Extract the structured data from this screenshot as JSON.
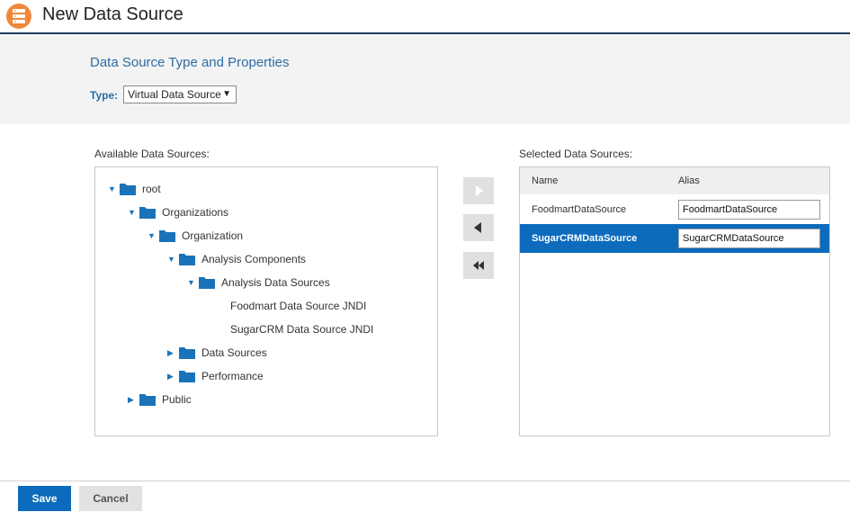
{
  "header": {
    "title": "New Data Source",
    "icon": "database-icon",
    "accent": "#f0883a"
  },
  "properties": {
    "heading": "Data Source Type and Properties",
    "type_label": "Type:",
    "type_value": "Virtual Data Source"
  },
  "available": {
    "label": "Available Data Sources:",
    "tree": [
      {
        "label": "root",
        "depth": 0,
        "expanded": true,
        "folder": true
      },
      {
        "label": "Organizations",
        "depth": 1,
        "expanded": true,
        "folder": true
      },
      {
        "label": "Organization",
        "depth": 2,
        "expanded": true,
        "folder": true
      },
      {
        "label": "Analysis Components",
        "depth": 3,
        "expanded": true,
        "folder": true
      },
      {
        "label": "Analysis Data Sources",
        "depth": 4,
        "expanded": true,
        "folder": true
      },
      {
        "label": "Foodmart Data Source JNDI",
        "depth": 5,
        "folder": false
      },
      {
        "label": "SugarCRM Data Source JNDI",
        "depth": 5,
        "folder": false
      },
      {
        "label": "Data Sources",
        "depth": 3,
        "expanded": false,
        "folder": true
      },
      {
        "label": "Performance",
        "depth": 3,
        "expanded": false,
        "folder": true
      },
      {
        "label": "Public",
        "depth": 1,
        "expanded": false,
        "folder": true
      }
    ]
  },
  "move_buttons": {
    "add": "arrow-right-icon",
    "remove": "arrow-left-icon",
    "remove_all": "double-arrow-left-icon"
  },
  "selected": {
    "label": "Selected Data Sources:",
    "columns": [
      "Name",
      "Alias"
    ],
    "rows": [
      {
        "name": "FoodmartDataSource",
        "alias": "FoodmartDataSource",
        "selected": false
      },
      {
        "name": "SugarCRMDataSource",
        "alias": "SugarCRMDataSource",
        "selected": true
      }
    ]
  },
  "footer": {
    "save_label": "Save",
    "cancel_label": "Cancel"
  },
  "colors": {
    "primary": "#0c6bbc",
    "heading": "#2c6ca4",
    "folder": "#1a73b8"
  }
}
